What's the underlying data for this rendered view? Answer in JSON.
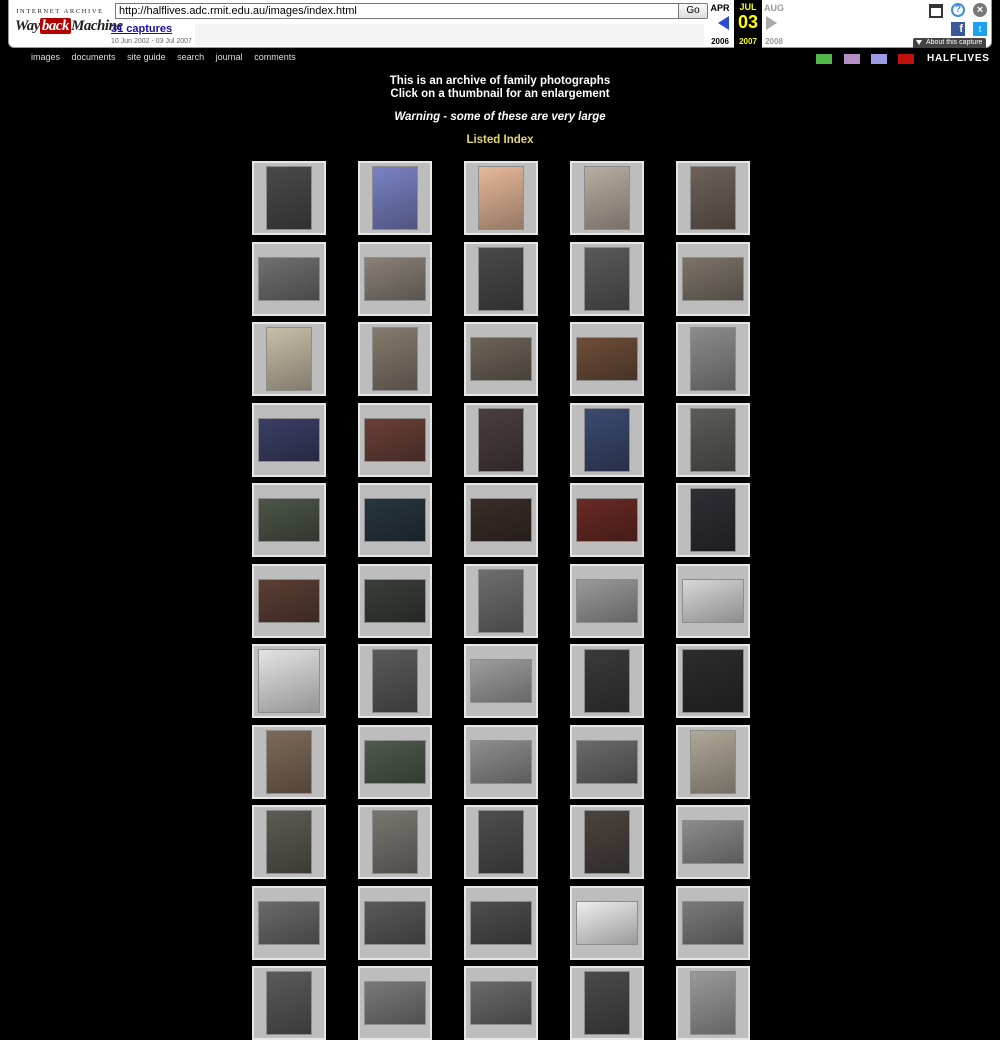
{
  "wayback": {
    "logo_top": "INTERNET ARCHIVE",
    "logo_way": "Way",
    "logo_back": "back",
    "logo_machine": "Machine",
    "url": "http://halflives.adc.rmit.edu.au/images/index.html",
    "go_label": "Go",
    "captures_label": "31 captures",
    "date_range": "10 Jun 2002 - 03 Jul 2007",
    "prev_month": "APR",
    "prev_year": "2006",
    "cur_month": "JUL",
    "cur_day": "03",
    "cur_year": "2007",
    "next_month": "AUG",
    "next_year": "2008",
    "about_label": "About this capture",
    "facebook_glyph": "f",
    "twitter_glyph": "t",
    "help_glyph": "?",
    "close_glyph": "×"
  },
  "nav": {
    "items": [
      "images",
      "documents",
      "site guide",
      "search",
      "journal",
      "comments"
    ]
  },
  "swatches": [
    "#4fb848",
    "#b48dc2",
    "#9a9ae8",
    "#c01010"
  ],
  "brand": "HALFLIVES",
  "header": {
    "line1": "This is an archive of family photographs",
    "line2": "Click on a thumbnail for an enlargement",
    "warning": "Warning - some of these are very large",
    "listed_index": "Listed Index"
  },
  "thumbnails": [
    [
      "p:#4a4a4a",
      "p:#7a82c4",
      "p:#e6b89a",
      "p:#b8ada0",
      "p:#6e6258"
    ],
    [
      "l:#707070",
      "l:#8a8178",
      "p:#4a4a4a",
      "p:#5a5a5a",
      "l:#7d7468"
    ],
    [
      "p:#c8bfa8",
      "p:#857a6d",
      "l:#6e6458",
      "l:#6e4e38",
      "p:#8c8c8c"
    ],
    [
      "l:#3b3f66",
      "l:#6a4038",
      "p:#4a3e3e",
      "p:#3c4a70",
      "p:#5c5c58"
    ],
    [
      "l:#4d5548",
      "l:#28363e",
      "l:#3a2e28",
      "l:#6a2a24",
      "p:#2e2e34"
    ],
    [
      "l:#5c3e34",
      "l:#3a3e3a",
      "p:#6e6e6e",
      "l:#9a9a9a",
      "l:#d8d8d8"
    ],
    [
      "s:#e4e4e4",
      "p:#5a5a5a",
      "l:#9e9e9e",
      "p:#3a3a3a",
      "s:#2c2c2c"
    ],
    [
      "p:#7e6a58",
      "l:#505a4e",
      "l:#8e8e8e",
      "l:#6a6a6a",
      "p:#b0a898"
    ],
    [
      "p:#5e5a54",
      "p:#7a7672",
      "p:#4e4e4e",
      "p:#4a4440",
      "l:#8c8c8c"
    ],
    [
      "l:#6a6a6a",
      "l:#5a5a5a",
      "l:#4e4e4e",
      "l:#eeeeee",
      "l:#7a7a7a"
    ],
    [
      "p:#5a5a5a",
      "l:#7a7a7a",
      "l:#6a6a6a",
      "p:#4a4a4a",
      "p:#9a9a9a"
    ]
  ]
}
